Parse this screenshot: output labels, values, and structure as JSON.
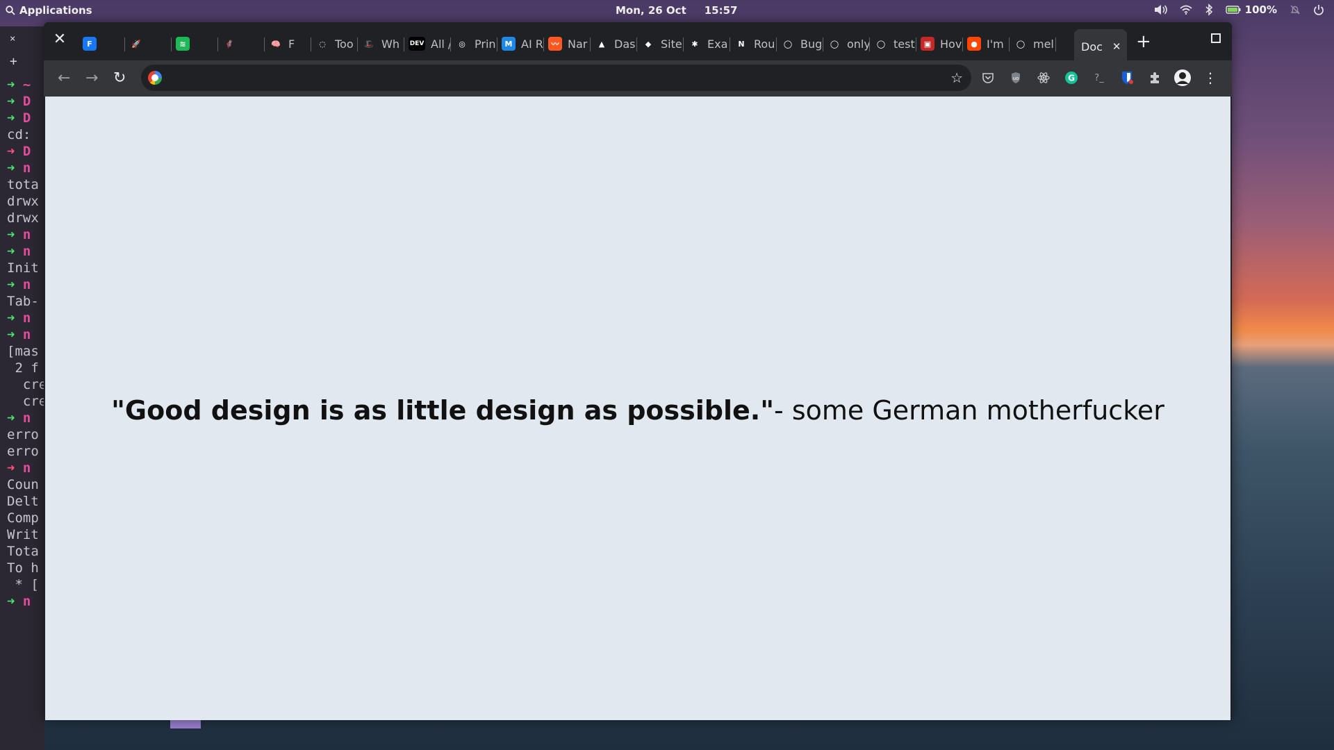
{
  "topbar": {
    "apps_label": "Applications",
    "date": "Mon, 26 Oct",
    "time": "15:57",
    "battery": "100%"
  },
  "terminal": {
    "close": "×",
    "add": "+",
    "lines": [
      {
        "arrow": "➜",
        "cls": "g",
        "text": " ~",
        "tcls": "m"
      },
      {
        "arrow": "➜",
        "cls": "g",
        "text": " D",
        "tcls": "m"
      },
      {
        "arrow": "➜",
        "cls": "g",
        "text": " D",
        "tcls": "m"
      },
      {
        "arrow": "",
        "cls": "",
        "text": "cd:",
        "tcls": ""
      },
      {
        "arrow": "➜",
        "cls": "p",
        "text": " D",
        "tcls": "m"
      },
      {
        "arrow": "➜",
        "cls": "g",
        "text": " n",
        "tcls": "m"
      },
      {
        "arrow": "",
        "cls": "",
        "text": "tota",
        "tcls": ""
      },
      {
        "arrow": "",
        "cls": "",
        "text": "drwx",
        "tcls": ""
      },
      {
        "arrow": "",
        "cls": "",
        "text": "drwx",
        "tcls": ""
      },
      {
        "arrow": "➜",
        "cls": "g",
        "text": " n",
        "tcls": "m"
      },
      {
        "arrow": "➜",
        "cls": "g",
        "text": " n",
        "tcls": "m"
      },
      {
        "arrow": "",
        "cls": "",
        "text": "Init",
        "tcls": ""
      },
      {
        "arrow": "➜",
        "cls": "g",
        "text": " n",
        "tcls": "m"
      },
      {
        "arrow": "",
        "cls": "",
        "text": "Tab-",
        "tcls": ""
      },
      {
        "arrow": "➜",
        "cls": "g",
        "text": " n",
        "tcls": "m"
      },
      {
        "arrow": "➜",
        "cls": "g",
        "text": " n",
        "tcls": "m"
      },
      {
        "arrow": "",
        "cls": "",
        "text": "[mas",
        "tcls": ""
      },
      {
        "arrow": "",
        "cls": "",
        "text": " 2 f",
        "tcls": ""
      },
      {
        "arrow": "",
        "cls": "",
        "text": "  cre",
        "tcls": ""
      },
      {
        "arrow": "",
        "cls": "",
        "text": "  cre",
        "tcls": ""
      },
      {
        "arrow": "➜",
        "cls": "g",
        "text": " n",
        "tcls": "m"
      },
      {
        "arrow": "",
        "cls": "",
        "text": "erro",
        "tcls": ""
      },
      {
        "arrow": "",
        "cls": "",
        "text": "erro",
        "tcls": ""
      },
      {
        "arrow": "➜",
        "cls": "p",
        "text": " n",
        "tcls": "m"
      },
      {
        "arrow": "",
        "cls": "",
        "text": "Coun",
        "tcls": ""
      },
      {
        "arrow": "",
        "cls": "",
        "text": "Delt",
        "tcls": ""
      },
      {
        "arrow": "",
        "cls": "",
        "text": "Comp",
        "tcls": ""
      },
      {
        "arrow": "",
        "cls": "",
        "text": "Writ",
        "tcls": ""
      },
      {
        "arrow": "",
        "cls": "",
        "text": "Tota",
        "tcls": ""
      },
      {
        "arrow": "",
        "cls": "",
        "text": "To h",
        "tcls": ""
      },
      {
        "arrow": "",
        "cls": "",
        "text": " * [",
        "tcls": ""
      },
      {
        "arrow": "➜",
        "cls": "g",
        "text": " n",
        "tcls": "m"
      }
    ]
  },
  "browser": {
    "tabs": [
      {
        "label": "",
        "icon": "fb-icon",
        "color": "#1877f2",
        "glyph": "F"
      },
      {
        "label": "",
        "icon": "rocket-icon",
        "color": "transparent",
        "glyph": "🚀"
      },
      {
        "label": "",
        "icon": "spotify-icon",
        "color": "#1db954",
        "glyph": "≋"
      },
      {
        "label": "",
        "icon": "emoji-icon",
        "color": "transparent",
        "glyph": "🦸"
      },
      {
        "label": "F",
        "icon": "brain-icon",
        "color": "transparent",
        "glyph": "🧠"
      },
      {
        "label": "Too",
        "icon": "globe-icon",
        "color": "transparent",
        "glyph": "◌"
      },
      {
        "label": "Wh",
        "icon": "redhat-icon",
        "color": "transparent",
        "glyph": "🎩"
      },
      {
        "label": "All /",
        "icon": "dev-icon",
        "color": "#000",
        "glyph": "DEV"
      },
      {
        "label": "Prin",
        "icon": "circle-icon",
        "color": "transparent",
        "glyph": "◎"
      },
      {
        "label": "AI R",
        "icon": "m-icon",
        "color": "#1e88e5",
        "glyph": "M"
      },
      {
        "label": "Nar",
        "icon": "wave-icon",
        "color": "#ff5722",
        "glyph": "〰"
      },
      {
        "label": "Das",
        "icon": "triangle-icon",
        "color": "transparent",
        "glyph": "▲"
      },
      {
        "label": "Site",
        "icon": "diamond-icon",
        "color": "transparent",
        "glyph": "◆"
      },
      {
        "label": "Exa",
        "icon": "asterisk-icon",
        "color": "transparent",
        "glyph": "✱"
      },
      {
        "label": "Rou",
        "icon": "n-icon",
        "color": "transparent",
        "glyph": "N"
      },
      {
        "label": "Bug",
        "icon": "github-icon",
        "color": "transparent",
        "glyph": "◯"
      },
      {
        "label": "only",
        "icon": "github-icon",
        "color": "transparent",
        "glyph": "◯"
      },
      {
        "label": "test",
        "icon": "github-icon",
        "color": "transparent",
        "glyph": "◯"
      },
      {
        "label": "Hov",
        "icon": "book-icon",
        "color": "#c62828",
        "glyph": "▣"
      },
      {
        "label": "I'm",
        "icon": "reddit-icon",
        "color": "#ff4500",
        "glyph": "●"
      },
      {
        "label": "mel",
        "icon": "github-icon",
        "color": "transparent",
        "glyph": "◯"
      }
    ],
    "active_tab": {
      "label": "Doc",
      "close": "✕"
    },
    "new_tab": "+",
    "url_value": "",
    "quote_bold": "\"Good design is as little design as possible.\"",
    "quote_rest": "- some German motherfucker"
  }
}
